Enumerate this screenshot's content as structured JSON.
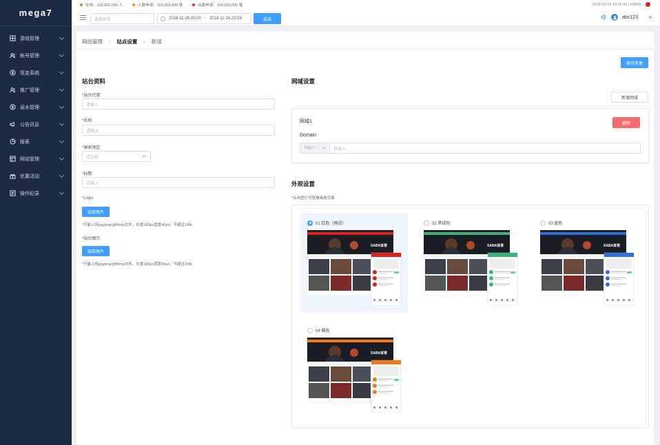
{
  "brand": {
    "logo": "mega7"
  },
  "sidebar": {
    "items": [
      {
        "label": "游戏管理",
        "icon": "grid-icon"
      },
      {
        "label": "帐号管理",
        "icon": "users-icon"
      },
      {
        "label": "现金系统",
        "icon": "coin-icon"
      },
      {
        "label": "推广管理",
        "icon": "users-icon"
      },
      {
        "label": "返水管理",
        "icon": "coin-icon"
      },
      {
        "label": "公告讯息",
        "icon": "megaphone-icon"
      },
      {
        "label": "报表",
        "icon": "pie-icon"
      },
      {
        "label": "网站管理",
        "icon": "layout-icon"
      },
      {
        "label": "优惠活动",
        "icon": "gift-icon"
      },
      {
        "label": "操作纪录",
        "icon": "list-icon"
      }
    ]
  },
  "topbar": {
    "stats": [
      {
        "text": "在线：100,000,000 人",
        "color": "#52c41a"
      },
      {
        "text": "入款申请：100,000,000 笔",
        "color": "#fa8c16"
      },
      {
        "text": "出款申请：100,000,000 笔",
        "color": "#f5222d"
      }
    ],
    "clock": "2018-10-03 15:25:40 (+0800)",
    "site_placeholder": "选择站台",
    "date_start": "2018-11-26 00:00",
    "date_sep": "-",
    "date_end": "2018-11-26 23:59",
    "search_label": "送出",
    "username": "abc123"
  },
  "breadcrumb": [
    "网站管理",
    "站点设置",
    "新增"
  ],
  "save_label": "保存变更",
  "site_info": {
    "title": "站台资料",
    "fields": [
      {
        "label": "*站台代號",
        "placeholder": "请输入"
      },
      {
        "label": "*名称",
        "placeholder": "请输入"
      },
      {
        "label": "*国家地区",
        "placeholder": "请选择"
      },
      {
        "label": "*标题",
        "placeholder": "请输入"
      }
    ],
    "logo_label": "*Logo",
    "logo_btn": "选取图片",
    "logo_hint": "*只能上传jpg/png/gif/bmp文件，长度180px宽度46px，不超过1Mb",
    "icon_label": "*站台图示",
    "icon_btn": "选取图片",
    "icon_hint": "*只能上传jpg/png/gif/bmp文件，长度180px宽度46px，不超过1Mb"
  },
  "domain": {
    "title": "网域设置",
    "add_label": "新增网域",
    "card_title": "网域1",
    "delete_label": "删除",
    "field_label": "Domain",
    "protocol": "http://",
    "placeholder": "请输入"
  },
  "appearance": {
    "title": "外观设置",
    "hint": "*点击图片可查看具放页面",
    "themes": [
      {
        "label": "01 红色（预设）",
        "accent": "#d9211f",
        "selected": true
      },
      {
        "label": "02 黑绿色",
        "accent": "#3cb37a",
        "selected": false
      },
      {
        "label": "03 蓝色",
        "accent": "#2f6fdb",
        "selected": false
      },
      {
        "label": "04 橘色",
        "accent": "#f07a1a",
        "selected": false
      }
    ],
    "preview_brand": "SABA体育"
  }
}
